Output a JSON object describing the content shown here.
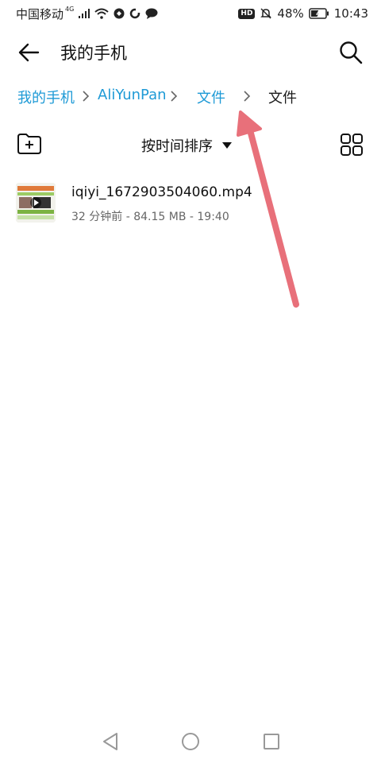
{
  "status_bar": {
    "carrier": "中国移动",
    "network": "4G",
    "hd": "HD",
    "battery": "48%",
    "time": "10:43"
  },
  "header": {
    "title": "我的手机"
  },
  "breadcrumb": {
    "items": [
      "我的手机",
      "AliYunPan",
      "文件",
      "文件"
    ]
  },
  "toolbar": {
    "sort_label": "按时间排序"
  },
  "files": [
    {
      "name": "iqiyi_1672903504060.mp4",
      "meta": "32 分钟前 - 84.15 MB - 19:40"
    }
  ],
  "colors": {
    "link": "#1e9ad6",
    "arrow": "#e8707a"
  }
}
